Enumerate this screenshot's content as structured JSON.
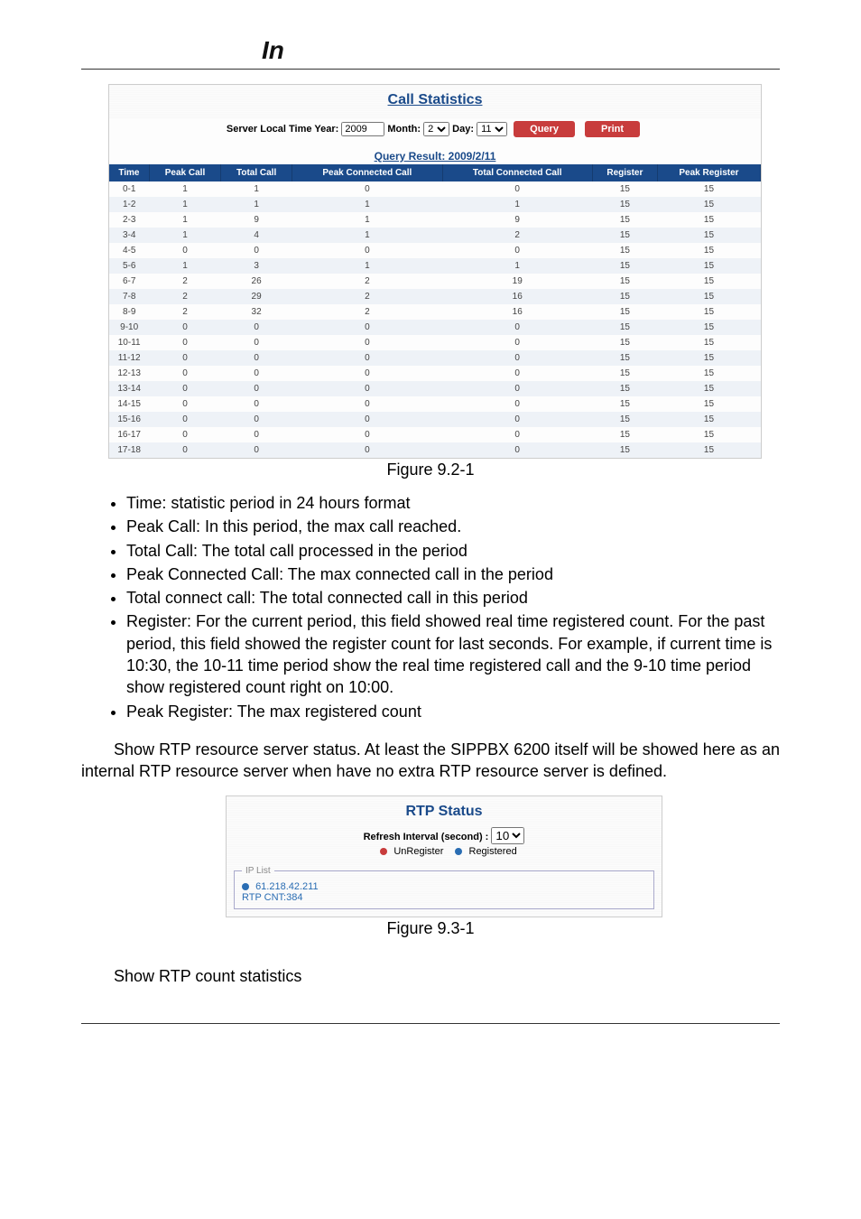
{
  "call_stat": {
    "title": "Call Statistics",
    "query_label_year": "Server Local Time Year:",
    "query_year": "2009",
    "query_label_month": "Month:",
    "query_month": "2",
    "query_label_day": "Day:",
    "query_day": "11",
    "btn_query": "Query",
    "btn_print": "Print",
    "result_title": "Query Result: 2009/2/11",
    "headers": [
      "Time",
      "Peak Call",
      "Total Call",
      "Peak Connected Call",
      "Total Connected Call",
      "Register",
      "Peak Register"
    ],
    "rows": [
      [
        "0-1",
        "1",
        "1",
        "0",
        "0",
        "15",
        "15"
      ],
      [
        "1-2",
        "1",
        "1",
        "1",
        "1",
        "15",
        "15"
      ],
      [
        "2-3",
        "1",
        "9",
        "1",
        "9",
        "15",
        "15"
      ],
      [
        "3-4",
        "1",
        "4",
        "1",
        "2",
        "15",
        "15"
      ],
      [
        "4-5",
        "0",
        "0",
        "0",
        "0",
        "15",
        "15"
      ],
      [
        "5-6",
        "1",
        "3",
        "1",
        "1",
        "15",
        "15"
      ],
      [
        "6-7",
        "2",
        "26",
        "2",
        "19",
        "15",
        "15"
      ],
      [
        "7-8",
        "2",
        "29",
        "2",
        "16",
        "15",
        "15"
      ],
      [
        "8-9",
        "2",
        "32",
        "2",
        "16",
        "15",
        "15"
      ],
      [
        "9-10",
        "0",
        "0",
        "0",
        "0",
        "15",
        "15"
      ],
      [
        "10-11",
        "0",
        "0",
        "0",
        "0",
        "15",
        "15"
      ],
      [
        "11-12",
        "0",
        "0",
        "0",
        "0",
        "15",
        "15"
      ],
      [
        "12-13",
        "0",
        "0",
        "0",
        "0",
        "15",
        "15"
      ],
      [
        "13-14",
        "0",
        "0",
        "0",
        "0",
        "15",
        "15"
      ],
      [
        "14-15",
        "0",
        "0",
        "0",
        "0",
        "15",
        "15"
      ],
      [
        "15-16",
        "0",
        "0",
        "0",
        "0",
        "15",
        "15"
      ],
      [
        "16-17",
        "0",
        "0",
        "0",
        "0",
        "15",
        "15"
      ],
      [
        "17-18",
        "0",
        "0",
        "0",
        "0",
        "15",
        "15"
      ]
    ]
  },
  "captions": {
    "fig921": "Figure 9.2-1",
    "fig931": "Figure 9.3-1"
  },
  "bullets": [
    "Time: statistic period in 24 hours format",
    "Peak Call: In this period, the max call reached.",
    "Total Call: The total call processed in the period",
    "Peak Connected Call: The max connected call in the period",
    "Total connect call: The total connected call in this period",
    "Register: For the current period, this field showed real time registered count. For the past period, this field showed the register count for last seconds. For example, if current time is 10:30, the 10-11 time period show the real time registered call and the 9-10 time period show registered count right on 10:00.",
    "Peak Register: The max registered count"
  ],
  "para1": "Show RTP resource server status. At least the SIPPBX 6200 itself will be showed here as an internal RTP resource server when have no extra RTP resource server is defined.",
  "rtp": {
    "title": "RTP Status",
    "refresh_label": "Refresh Interval (second) :",
    "refresh_value": "10",
    "legend_unreg": "UnRegister",
    "legend_reg": "Registered",
    "iplist_legend": "IP List",
    "ip_line1": "61.218.42.211",
    "ip_line2": "RTP CNT:384"
  },
  "para2": "Show RTP count statistics",
  "logo_alt": "In"
}
